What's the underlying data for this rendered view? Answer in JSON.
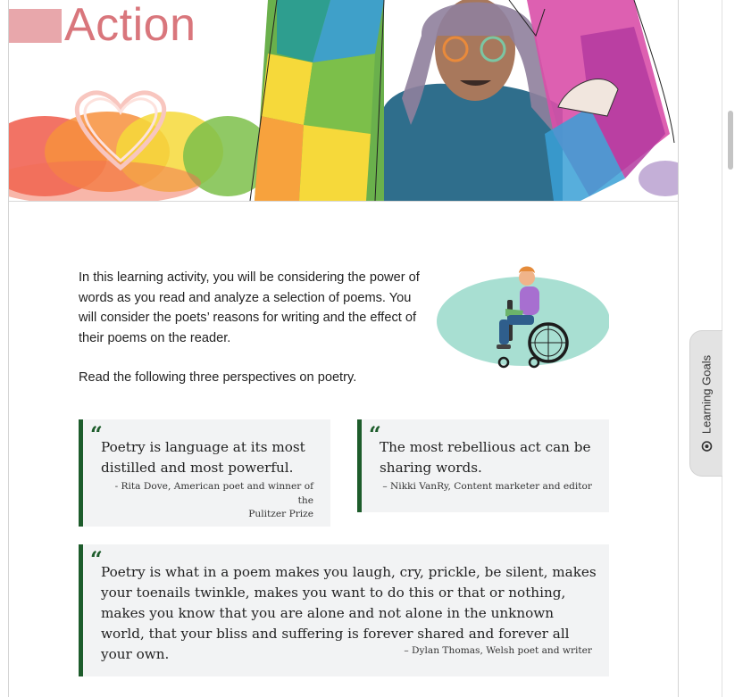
{
  "hero": {
    "title": "Action"
  },
  "intro": {
    "paragraph1": "In this learning activity, you will be considering the power of words as you read and analyze a selection of poems. You will consider the poets’ reasons for writing and the effect of their poems on the reader.",
    "paragraph2": "Read the following three perspectives on poetry."
  },
  "quotes": [
    {
      "mark": "“",
      "text": "Poetry is language at its most distilled and most powerful.",
      "attribution_line1": "- Rita Dove, American poet and winner of the",
      "attribution_line2": "Pulitzer Prize"
    },
    {
      "mark": "“",
      "text": "The most rebellious act can be sharing words.",
      "attribution_line1": "– Nikki VanRy, Content marketer and editor"
    },
    {
      "mark": "“",
      "text": "Poetry is what in a poem makes you laugh, cry, prickle, be silent, makes your toenails twinkle, makes you want to do this or that or nothing, makes you know that you are alone and not alone in the unknown world, that your bliss and suffering is forever shared and forever all your own.",
      "attribution_line1": "– Dylan Thomas, Welsh poet and writer"
    }
  ],
  "side_tab": {
    "label": "Learning Goals",
    "icon": "target-icon"
  },
  "colors": {
    "accent_green": "#1d5c2b",
    "title_pink": "#d9767c",
    "quote_bg": "#f2f3f4"
  }
}
